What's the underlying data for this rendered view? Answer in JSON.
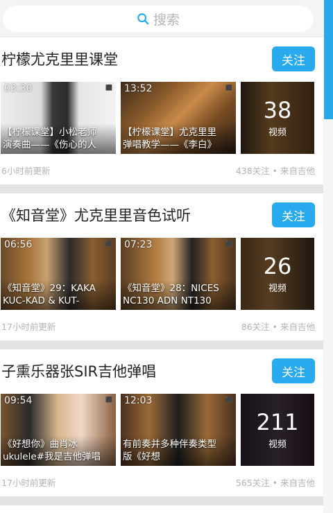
{
  "search": {
    "placeholder": "搜索"
  },
  "colors": {
    "accent": "#29a9ee",
    "scrollbar": "#27a8e8"
  },
  "cards": [
    {
      "title": "柠檬尤克里里课堂",
      "follow_label": "关注",
      "videos": [
        {
          "duration": "03:30",
          "title_line1": "【柠檬课堂】小松老师",
          "title_line2": "演奏曲——《伤心的人"
        },
        {
          "duration": "13:52",
          "title_line1": "【柠檬课堂】尤克里里",
          "title_line2": "弹唱教学——《李白》"
        }
      ],
      "video_count": "38",
      "video_count_label": "视频",
      "updated": "6小时前更新",
      "stats": "438关注 • 来自吉他"
    },
    {
      "title": "《知音堂》尤克里里音色试听",
      "follow_label": "关注",
      "videos": [
        {
          "duration": "06:56",
          "title_line1": "《知音堂》29：KAKA",
          "title_line2": "KUC-KAD & KUT-"
        },
        {
          "duration": "07:23",
          "title_line1": "《知音堂》28：NICES",
          "title_line2": "NC130 ADN NT130"
        }
      ],
      "video_count": "26",
      "video_count_label": "视频",
      "updated": "17小时前更新",
      "stats": "86关注 • 来自吉他"
    },
    {
      "title": "子熏乐器张SIR吉他弹唱",
      "follow_label": "关注",
      "videos": [
        {
          "duration": "09:54",
          "title_line1": "《好想你》曲肖冰",
          "title_line2": "ukulele#我是吉他弹唱"
        },
        {
          "duration": "12:03",
          "title_line1": "有前奏并多种伴奏类型",
          "title_line2": "版《好想"
        }
      ],
      "video_count": "211",
      "video_count_label": "视频",
      "updated": "17小时前更新",
      "stats": "565关注 • 来自吉他"
    }
  ]
}
